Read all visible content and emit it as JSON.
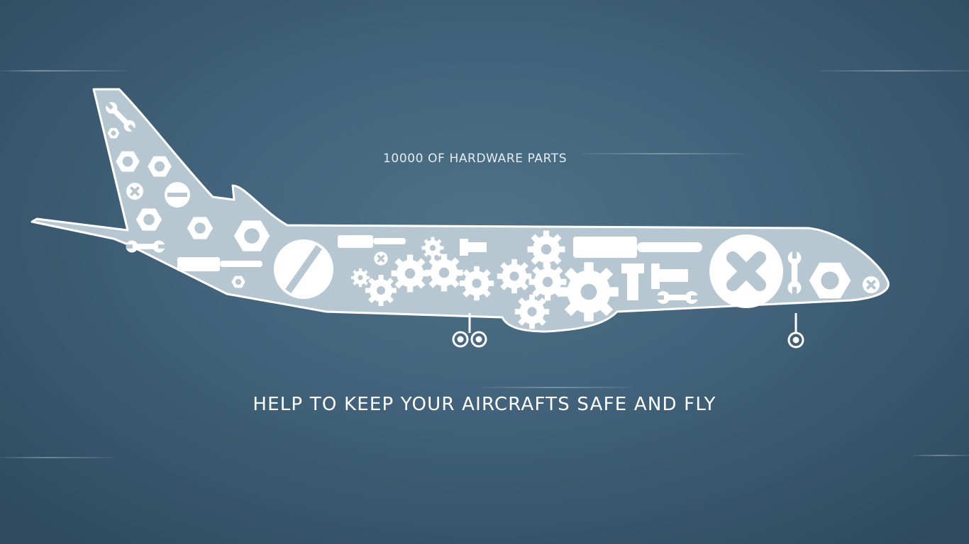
{
  "scene": {
    "subtitle": "10000 OF HARDWARE PARTS",
    "headline": "HELP TO KEEP YOUR AIRCRAFTS SAFE AND FLY"
  },
  "colors": {
    "background": "#41627a",
    "plane_fill": "#b6c7d2",
    "plane_outline": "#ffffff",
    "parts": "#ffffff"
  },
  "icons": [
    "airplane-illustration",
    "wrench-icon",
    "hex-nut-icon",
    "screw-head-icon",
    "gear-icon",
    "bolt-icon",
    "screwdriver-icon",
    "landing-gear-wheel-icon"
  ]
}
